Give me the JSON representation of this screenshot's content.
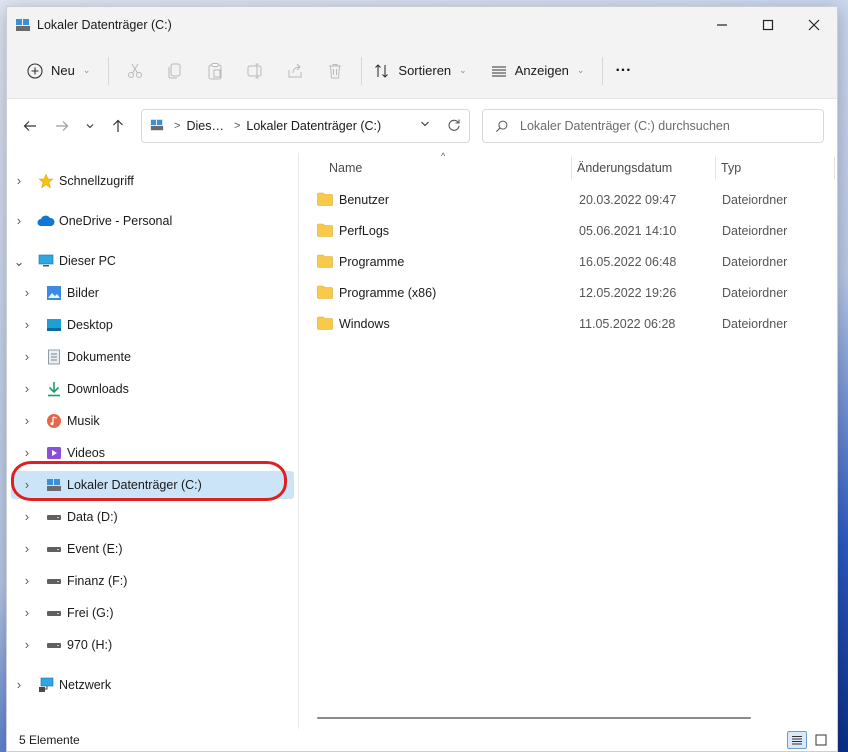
{
  "window": {
    "title": "Lokaler Datenträger (C:)"
  },
  "toolbar": {
    "new_label": "Neu",
    "sort_label": "Sortieren",
    "view_label": "Anzeigen",
    "more_label": "···"
  },
  "address": {
    "crumbs": [
      "Dies…",
      "Lokaler Datenträger (C:)"
    ]
  },
  "search": {
    "placeholder": "Lokaler Datenträger (C:) durchsuchen"
  },
  "sidebar": {
    "items": [
      {
        "label": "Schnellzugriff",
        "icon": "star-icon",
        "expander": "collapsed"
      },
      {
        "label": "OneDrive - Personal",
        "icon": "cloud-icon",
        "expander": "collapsed"
      },
      {
        "label": "Dieser PC",
        "icon": "monitor-icon",
        "expander": "expanded"
      },
      {
        "label": "Bilder",
        "icon": "pictures-icon",
        "expander": "collapsed"
      },
      {
        "label": "Desktop",
        "icon": "desktop-icon",
        "expander": "collapsed"
      },
      {
        "label": "Dokumente",
        "icon": "documents-icon",
        "expander": "collapsed"
      },
      {
        "label": "Downloads",
        "icon": "download-icon",
        "expander": "collapsed"
      },
      {
        "label": "Musik",
        "icon": "music-icon",
        "expander": "collapsed"
      },
      {
        "label": "Videos",
        "icon": "video-icon",
        "expander": "collapsed"
      },
      {
        "label": "Lokaler Datenträger (C:)",
        "icon": "system-drive-icon",
        "expander": "collapsed",
        "selected": true
      },
      {
        "label": "Data (D:)",
        "icon": "drive-icon",
        "expander": "collapsed"
      },
      {
        "label": "Event (E:)",
        "icon": "drive-icon",
        "expander": "collapsed"
      },
      {
        "label": "Finanz (F:)",
        "icon": "drive-icon",
        "expander": "collapsed"
      },
      {
        "label": "Frei (G:)",
        "icon": "drive-icon",
        "expander": "collapsed"
      },
      {
        "label": "970 (H:)",
        "icon": "drive-icon",
        "expander": "collapsed"
      },
      {
        "label": "Netzwerk",
        "icon": "network-icon",
        "expander": "collapsed"
      }
    ]
  },
  "list": {
    "columns": [
      "Name",
      "Änderungsdatum",
      "Typ"
    ],
    "rows": [
      {
        "name": "Benutzer",
        "date": "20.03.2022 09:47",
        "type": "Dateiordner"
      },
      {
        "name": "PerfLogs",
        "date": "05.06.2021 14:10",
        "type": "Dateiordner"
      },
      {
        "name": "Programme",
        "date": "16.05.2022 06:48",
        "type": "Dateiordner"
      },
      {
        "name": "Programme (x86)",
        "date": "12.05.2022 19:26",
        "type": "Dateiordner"
      },
      {
        "name": "Windows",
        "date": "11.05.2022 06:28",
        "type": "Dateiordner"
      }
    ]
  },
  "status": {
    "count_text": "5 Elemente"
  },
  "colors": {
    "accent": "#0067c0",
    "selection": "#cce4f7",
    "highlight_ring": "#e02020",
    "folder": "#f8c94a"
  }
}
